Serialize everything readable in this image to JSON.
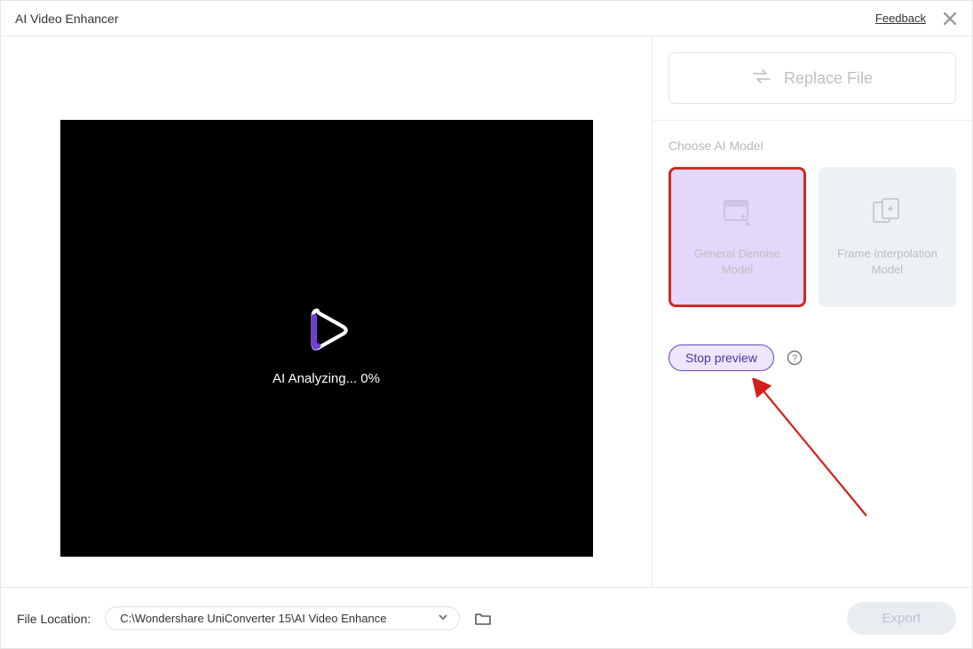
{
  "header": {
    "title": "AI Video Enhancer",
    "feedback": "Feedback"
  },
  "video": {
    "status": "AI Analyzing... 0%"
  },
  "sidebar": {
    "replace_label": "Replace File",
    "section_label": "Choose AI Model",
    "models": [
      {
        "label_line1": "General Denoise",
        "label_line2": "Model"
      },
      {
        "label_line1": "Frame Interpolation",
        "label_line2": "Model"
      }
    ],
    "stop_label": "Stop preview"
  },
  "footer": {
    "file_location_label": "File Location:",
    "file_location_value": "C:\\Wondershare UniConverter 15\\AI Video Enhance",
    "export_label": "Export"
  }
}
